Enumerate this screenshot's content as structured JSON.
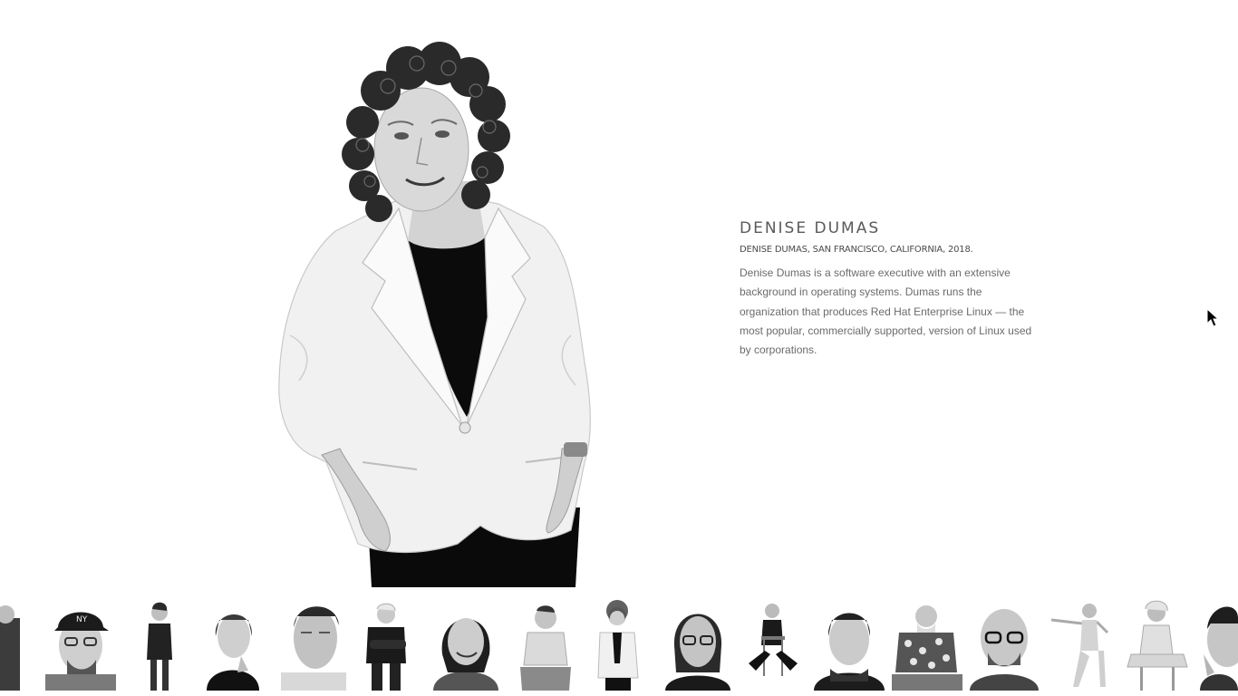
{
  "featured": {
    "name": "DENISE DUMAS",
    "caption": "DENISE DUMAS, SAN FRANCISCO, CALIFORNIA, 2018.",
    "description": "Denise Dumas is a software executive with an extensive background in operating systems. Dumas runs the organization that produces Red Hat Enterprise Linux — the most popular, commercially supported, version of Linux used by corporations."
  },
  "thumbnails": [
    {
      "icon": "portrait-partial-left"
    },
    {
      "icon": "portrait-man-ny-cap"
    },
    {
      "icon": "portrait-woman-standing"
    },
    {
      "icon": "portrait-woman-hand-chin"
    },
    {
      "icon": "portrait-older-man"
    },
    {
      "icon": "portrait-man-arms-crossed"
    },
    {
      "icon": "portrait-woman-smiling"
    },
    {
      "icon": "portrait-man-crouching"
    },
    {
      "icon": "portrait-woman-white-jacket"
    },
    {
      "icon": "portrait-man-glasses-long-hair"
    },
    {
      "icon": "portrait-man-on-chair"
    },
    {
      "icon": "portrait-woman-short-hair"
    },
    {
      "icon": "portrait-man-floral-shirt"
    },
    {
      "icon": "portrait-man-bald-glasses"
    },
    {
      "icon": "portrait-woman-dancing"
    },
    {
      "icon": "portrait-woman-seated-stool"
    },
    {
      "icon": "portrait-partial-right"
    }
  ],
  "colors": {
    "background": "#ffffff",
    "text_heading": "#5a5a5a",
    "text_body": "#6b6b6b"
  }
}
